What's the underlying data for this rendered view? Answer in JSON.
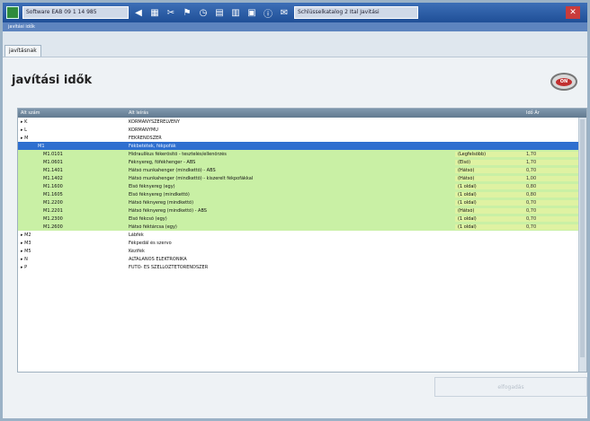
{
  "window": {
    "title_field": "Software   EAB 09 1  14  985",
    "path_field": "Schlüsselkatalog  2  Ital  Javitási",
    "crumb": "javítási idők",
    "tab": "javításnak",
    "close_icon": "close-icon"
  },
  "toolbar": {
    "icons": [
      "arrow-left-icon",
      "document-icon",
      "scissors-icon",
      "flag-icon",
      "clock-icon",
      "cart-icon",
      "printer-icon",
      "folder-icon",
      "info-icon",
      "mail-icon"
    ]
  },
  "page": {
    "title": "javítási idők",
    "brand": "ON"
  },
  "table": {
    "headers": [
      "Alt szám",
      "Alt leírás",
      "",
      "Idő Ár"
    ],
    "rows": [
      {
        "c1": "▸ K",
        "c2": "KORMÁNYSZERELVÉNY",
        "c3": "",
        "c4": "",
        "type": "white"
      },
      {
        "c1": "▸ L",
        "c2": "KORMÁNYMŰ",
        "c3": "",
        "c4": "",
        "type": "white"
      },
      {
        "c1": "▸ M",
        "c2": "FÉKRENDSZER",
        "c3": "",
        "c4": "",
        "type": "white"
      },
      {
        "c1": "M1",
        "c2": "Fékbetétek, fékpofák",
        "c3": "",
        "c4": "",
        "type": "selected"
      },
      {
        "c1": "M1.0101",
        "c2": "Hidraulikus fékerősítő - tesztelés/ellenőrzés",
        "c3": "(Legfelsőbb)",
        "c4": "1,70",
        "type": "green"
      },
      {
        "c1": "M1.0601",
        "c2": "Féknyereg, főfékhenger - ABS",
        "c3": "(Első)",
        "c4": "1,70",
        "type": "green"
      },
      {
        "c1": "M1.1401",
        "c2": "Hátsó munkahenger (mindkettő) - ABS",
        "c3": "(Hátsó)",
        "c4": "0,70",
        "type": "green"
      },
      {
        "c1": "M1.1402",
        "c2": "Hátsó munkahenger (mindkettő) - kiszerelt fékpofákkal",
        "c3": "(Hátsó)",
        "c4": "1,00",
        "type": "green"
      },
      {
        "c1": "M1.1600",
        "c2": "Első féknyereg (egy)",
        "c3": "(1 oldal)",
        "c4": "0,80",
        "type": "green"
      },
      {
        "c1": "M1.1605",
        "c2": "Első féknyereg (mindkettő)",
        "c3": "(1 oldal)",
        "c4": "0,80",
        "type": "green"
      },
      {
        "c1": "M1.2200",
        "c2": "Hátsó féknyereg (mindkettő)",
        "c3": "(1 oldal)",
        "c4": "0,70",
        "type": "green"
      },
      {
        "c1": "M1.2201",
        "c2": "Hátsó féknyereg (mindkettő) - ABS",
        "c3": "(Hátsó)",
        "c4": "0,70",
        "type": "green"
      },
      {
        "c1": "M1.2300",
        "c2": "Első fékcső (egy)",
        "c3": "(1 oldal)",
        "c4": "0,70",
        "type": "green"
      },
      {
        "c1": "M1.2600",
        "c2": "Hátsó féktárcsa (egy)",
        "c3": "(1 oldal)",
        "c4": "0,70",
        "type": "green"
      },
      {
        "c1": "▸ M2",
        "c2": "Lábfék",
        "c3": "",
        "c4": "",
        "type": "white"
      },
      {
        "c1": "▸ M3",
        "c2": "Fékpedál és szervo",
        "c3": "",
        "c4": "",
        "type": "white"
      },
      {
        "c1": "▸ M5",
        "c2": "Kézifék",
        "c3": "",
        "c4": "",
        "type": "white"
      },
      {
        "c1": "▸ N",
        "c2": "ÁLTALÁNOS ELEKTRONIKA",
        "c3": "",
        "c4": "",
        "type": "white"
      },
      {
        "c1": "▸ P",
        "c2": "FŰTŐ- ÉS SZELLŐZTETŐRENDSZER",
        "c3": "",
        "c4": "",
        "type": "white"
      }
    ]
  },
  "footer": {
    "button": "elfogadás"
  },
  "colors": {
    "titlebar": "#1f4f97",
    "selected": "#2f6fcf",
    "green": "#c9f0a5"
  }
}
